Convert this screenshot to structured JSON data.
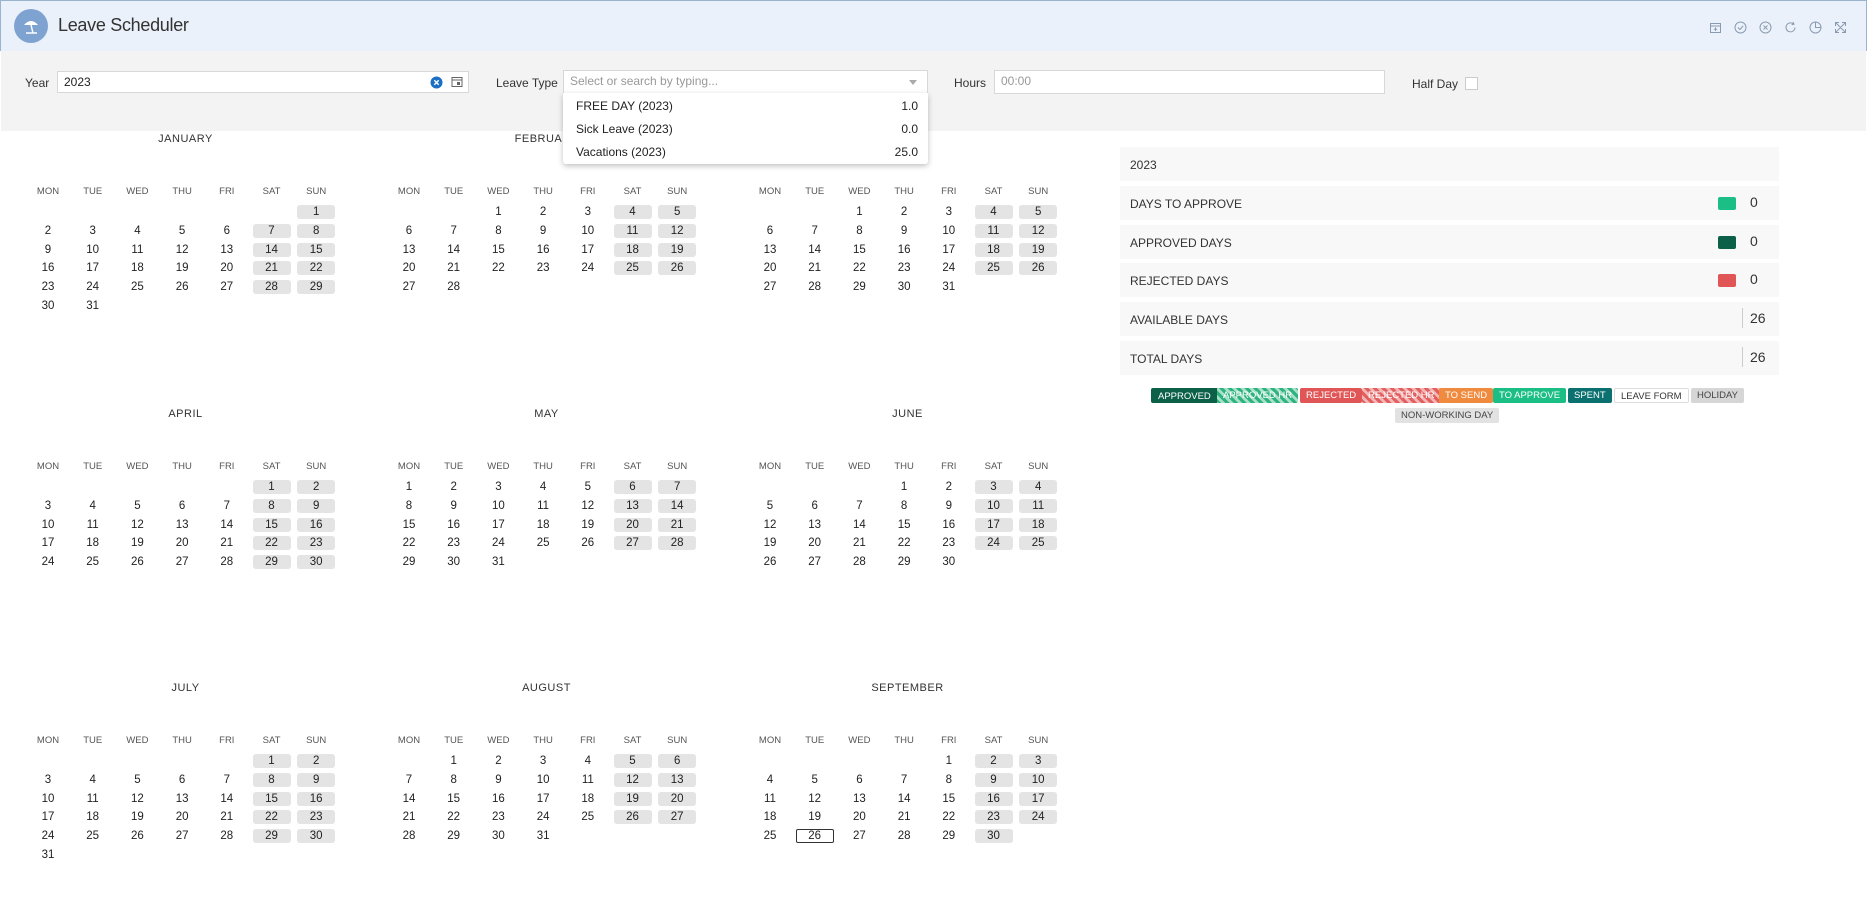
{
  "app": {
    "title": "Leave Scheduler"
  },
  "filters": {
    "year_label": "Year",
    "year_value": "2023",
    "leave_type_label": "Leave Type",
    "leave_type_placeholder": "Select or search by typing...",
    "hours_label": "Hours",
    "hours_placeholder": "00:00",
    "half_day_label": "Half Day"
  },
  "leave_options": [
    {
      "name": "FREE DAY (2023)",
      "value": "1.0"
    },
    {
      "name": "Sick Leave (2023)",
      "value": "0.0"
    },
    {
      "name": "Vacations (2023)",
      "value": "25.0"
    }
  ],
  "weekdays": [
    "MON",
    "TUE",
    "WED",
    "THU",
    "FRI",
    "SAT",
    "SUN"
  ],
  "calendar": {
    "months": [
      {
        "name": "JANUARY",
        "start": 6,
        "days": 31
      },
      {
        "name": "FEBRUARY",
        "start": 2,
        "days": 28
      },
      {
        "name": "",
        "start": 2,
        "days": 31
      },
      {
        "name": "APRIL",
        "start": 5,
        "days": 30
      },
      {
        "name": "MAY",
        "start": 0,
        "days": 31
      },
      {
        "name": "JUNE",
        "start": 3,
        "days": 30
      },
      {
        "name": "JULY",
        "start": 5,
        "days": 31
      },
      {
        "name": "AUGUST",
        "start": 1,
        "days": 31
      },
      {
        "name": "SEPTEMBER",
        "start": 4,
        "days": 30
      }
    ],
    "today": {
      "month": 8,
      "day": 26
    }
  },
  "summary": {
    "year": "2023",
    "rows": [
      {
        "label": "DAYS TO APPROVE",
        "value": "0",
        "color": "#1bbf85"
      },
      {
        "label": "APPROVED DAYS",
        "value": "0",
        "color": "#0c6048"
      },
      {
        "label": "REJECTED DAYS",
        "value": "0",
        "color": "#e05555"
      },
      {
        "label": "AVAILABLE DAYS",
        "value": "26",
        "color": ""
      },
      {
        "label": "TOTAL DAYS",
        "value": "26",
        "color": ""
      }
    ]
  },
  "legend": [
    {
      "label": "APPROVED",
      "style": "approved"
    },
    {
      "label": "APPROVED HR",
      "style": "approved-hr"
    },
    {
      "label": "REJECTED",
      "style": "rejected"
    },
    {
      "label": "REJECTED HR",
      "style": "rejected-hr"
    },
    {
      "label": "TO SEND",
      "style": "to-send"
    },
    {
      "label": "TO APPROVE",
      "style": "to-approve"
    },
    {
      "label": "SPENT",
      "style": "spent"
    },
    {
      "label": "LEAVE FORM",
      "style": "leave-form"
    },
    {
      "label": "HOLIDAY",
      "style": "holiday"
    },
    {
      "label": "NON-WORKING DAY",
      "style": "non-working"
    }
  ],
  "icons": {
    "window": [
      "calendar-add-icon",
      "check-circle-icon",
      "close-circle-icon",
      "refresh-icon",
      "chart-pie-icon",
      "fullscreen-icon"
    ]
  }
}
